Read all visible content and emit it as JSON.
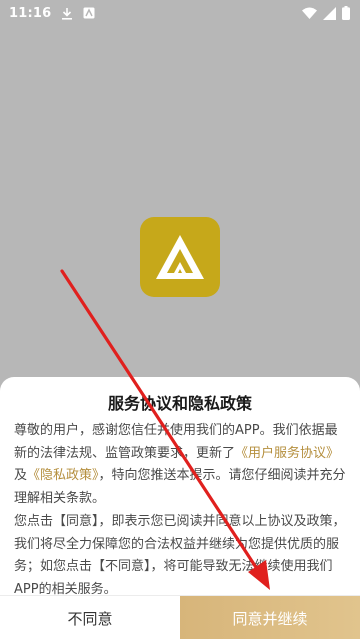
{
  "status_bar": {
    "time": "11:16",
    "left_icons": [
      "download-icon",
      "app-notification-icon"
    ],
    "right_icons": [
      "wifi-icon",
      "signal-icon",
      "battery-icon"
    ]
  },
  "app": {
    "logo_icon": "app-logo-icon",
    "logo_color": "#c6a81a"
  },
  "dialog": {
    "title": "服务协议和隐私政策",
    "para1_part1": "尊敬的用户，感谢您信任并使用我们的APP。我们依据最新的法律法规、监管政策要求，更新了",
    "service_link": "《用户服务协议》",
    "para1_and": "及",
    "privacy_link": "《隐私政策》",
    "para1_part2": "，特向您推送本提示。请您仔细阅读并充分理解相关条款。",
    "para2": "您点击【同意】，即表示您已阅读并同意以上协议及政策，我们将尽全力保障您的合法权益并继续为您提供优质的服务；如您点击【不同意】，将可能导致无法继续使用我们APP的相关服务。",
    "link_color": "#b58f3e"
  },
  "buttons": {
    "disagree": "不同意",
    "agree": "同意并继续",
    "agree_color": "#d7b57a"
  },
  "annotation": {
    "arrow_color": "#e0201e"
  }
}
